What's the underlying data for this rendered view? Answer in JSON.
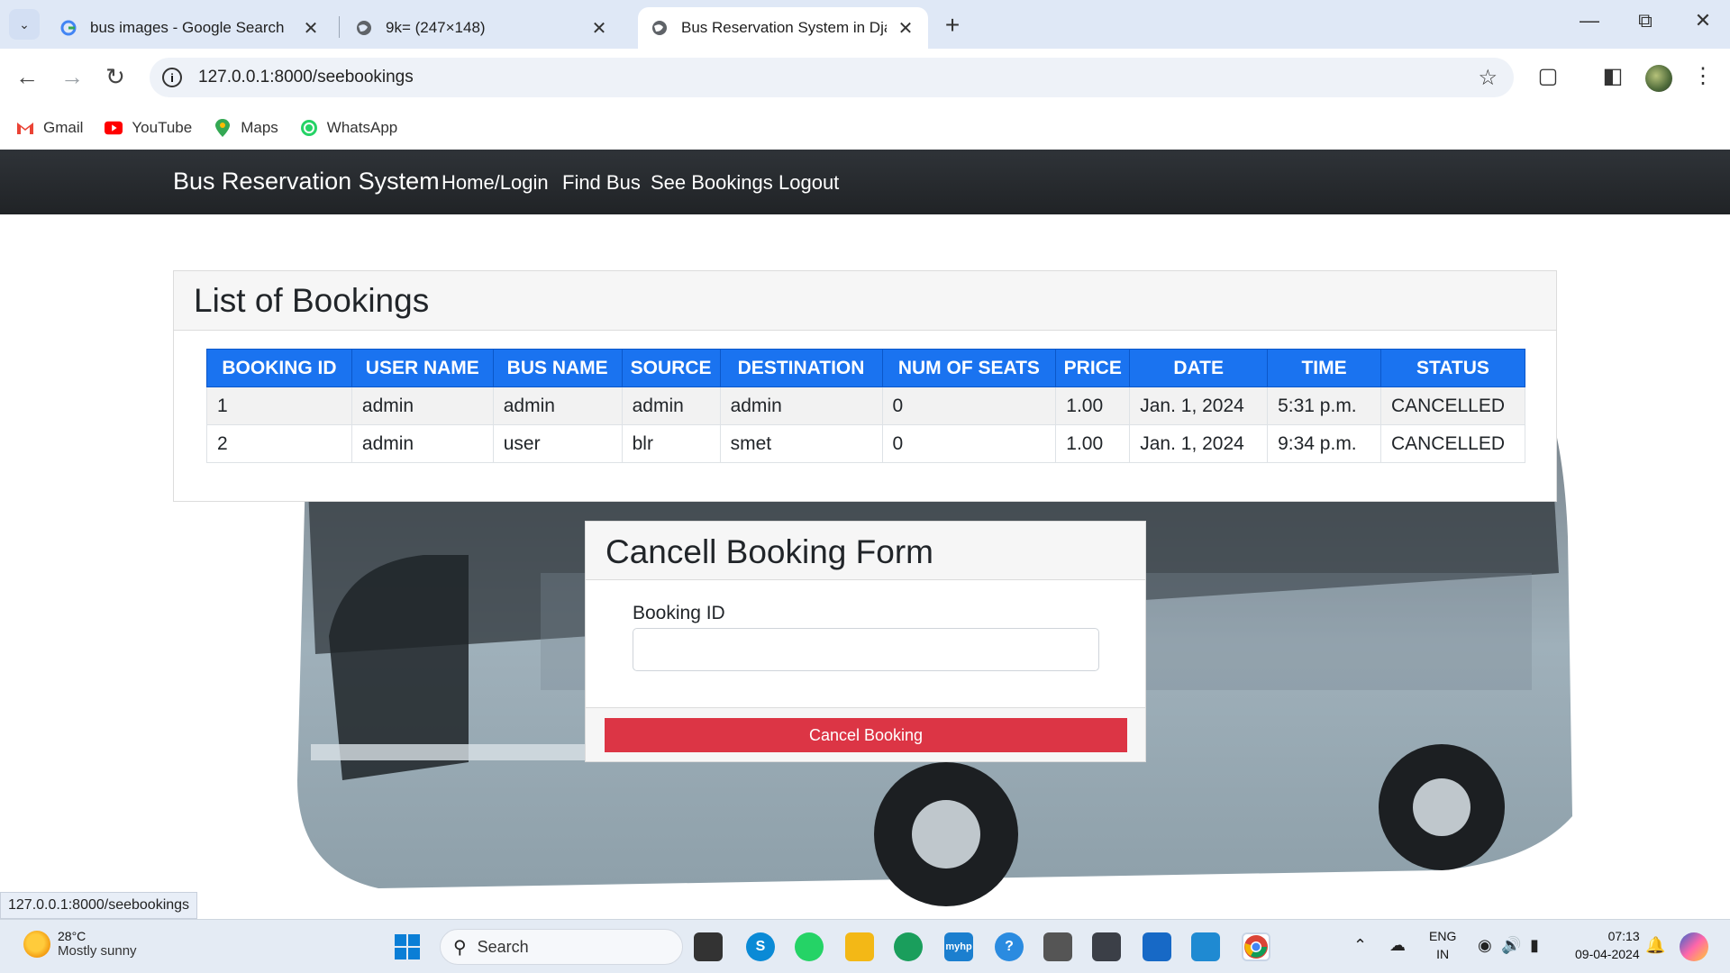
{
  "browser": {
    "tabs": [
      {
        "title": "bus images - Google Search"
      },
      {
        "title": "9k= (247×148)"
      },
      {
        "title": "Bus Reservation System in Djan",
        "active": true
      }
    ],
    "url": "127.0.0.1:8000/seebookings",
    "bookmarks": [
      {
        "label": "Gmail"
      },
      {
        "label": "YouTube"
      },
      {
        "label": "Maps"
      },
      {
        "label": "WhatsApp"
      }
    ],
    "status_url": "127.0.0.1:8000/seebookings"
  },
  "nav": {
    "brand": "Bus Reservation System",
    "links": [
      "Home/Login",
      "Find Bus",
      "See Bookings",
      "Logout"
    ]
  },
  "bookings": {
    "title": "List of Bookings",
    "columns": [
      "BOOKING ID",
      "USER NAME",
      "BUS NAME",
      "SOURCE",
      "DESTINATION",
      "NUM OF SEATS",
      "PRICE",
      "DATE",
      "TIME",
      "STATUS"
    ],
    "rows": [
      [
        "1",
        "admin",
        "admin",
        "admin",
        "admin",
        "0",
        "1.00",
        "Jan. 1, 2024",
        "5:31 p.m.",
        "CANCELLED"
      ],
      [
        "2",
        "admin",
        "user",
        "blr",
        "smet",
        "0",
        "1.00",
        "Jan. 1, 2024",
        "9:34 p.m.",
        "CANCELLED"
      ]
    ]
  },
  "cancel_form": {
    "title": "Cancell Booking Form",
    "field_label": "Booking ID",
    "field_value": "",
    "button_label": "Cancel Booking"
  },
  "taskbar": {
    "weather_temp": "28°C",
    "weather_desc": "Mostly sunny",
    "search_label": "Search",
    "lang_line1": "ENG",
    "lang_line2": "IN",
    "time": "07:13",
    "date": "09-04-2024"
  },
  "colors": {
    "table_header": "#1a73f0",
    "cancel_button": "#dc3545",
    "navbar": "#212529"
  }
}
